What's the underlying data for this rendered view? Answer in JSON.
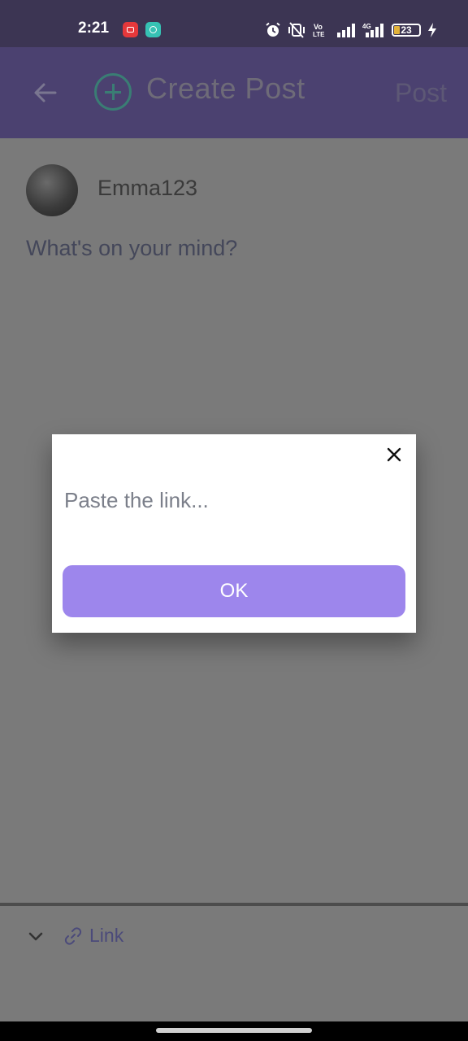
{
  "status_bar": {
    "time": "2:21",
    "notification_icons": [
      "screen-recorder-icon",
      "chat-bubble-icon"
    ],
    "system_icons": [
      "alarm-icon",
      "vibrate-off-icon",
      "volte-icon",
      "signal-icon",
      "4g-signal-icon"
    ],
    "volte_label": "Vo LTE",
    "network_label": "4G",
    "battery_level": "23",
    "charging": true
  },
  "appbar": {
    "title": "Create Post",
    "post_label": "Post",
    "colors": {
      "background": "#4b4170",
      "plus_icon": "#3a7d74"
    }
  },
  "composer": {
    "username": "Emma123",
    "placeholder": "What's on your mind?"
  },
  "dialog": {
    "input_placeholder": "Paste the link...",
    "input_value": "",
    "ok_label": "OK",
    "colors": {
      "ok_button": "#9d86ec"
    }
  },
  "bottom_toolbar": {
    "link_label": "Link"
  }
}
